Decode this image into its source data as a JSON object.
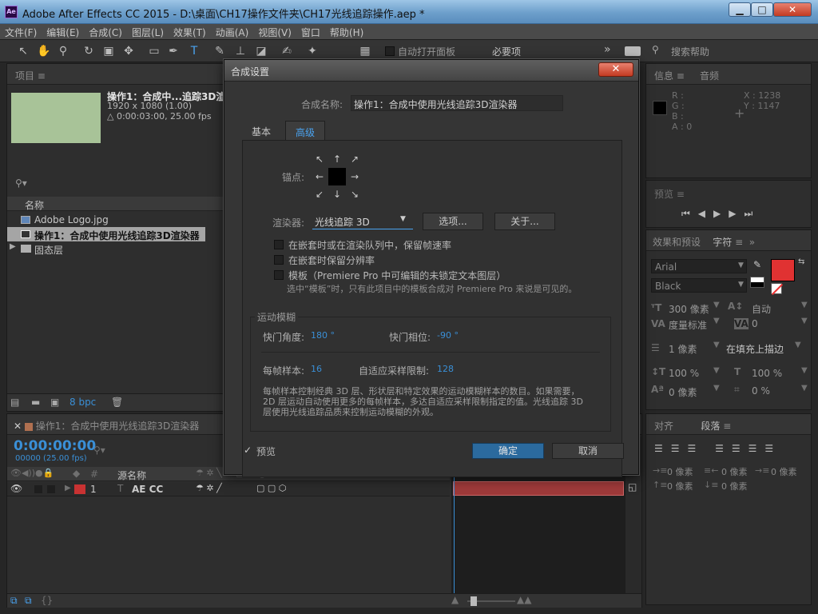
{
  "window": {
    "app_icon": "Ae",
    "title": "Adobe After Effects CC 2015 - D:\\桌面\\CH17操作文件夹\\CH17光线追踪操作.aep *",
    "controls": [
      "▁",
      "□",
      "✕"
    ]
  },
  "menu": [
    "文件(F)",
    "编辑(E)",
    "合成(C)",
    "图层(L)",
    "效果(T)",
    "动画(A)",
    "视图(V)",
    "窗口",
    "帮助(H)"
  ],
  "toolbar": {
    "auto_open_label": "自动打开面板",
    "workspace": "必要项",
    "search_help": "搜索帮助"
  },
  "project": {
    "tab": "项目",
    "comp_name": "操作1：合成中...追踪3D渲",
    "comp_resolution": "1920 x 1080 (1.00)",
    "comp_duration": "△ 0:00:03:00, 25.00 fps",
    "thumb_color": "#a8c398",
    "column_name": "名称",
    "items": [
      {
        "icon": "image-icon",
        "name": "Adobe Logo.jpg"
      },
      {
        "icon": "comp-icon",
        "name": "操作1：合成中使用光线追踪3D渲染器"
      },
      {
        "icon": "folder-icon",
        "name": "固态层"
      }
    ],
    "bpc": "8 bpc"
  },
  "info": {
    "tab_info": "信息",
    "tab_audio": "音频",
    "r": "R :",
    "g": "G :",
    "b": "B :",
    "a": "A : 0",
    "x": "X : 1238",
    "y": "Y : 1147"
  },
  "preview": {
    "tab": "预览"
  },
  "character": {
    "tab_effects": "效果和预设",
    "tab_char": "字符",
    "font": "Arial",
    "style": "Black",
    "size": "300 像素",
    "leading": "自动",
    "kerning": "度量标准",
    "tracking": "0",
    "stroke_width": "1 像素",
    "stroke_type": "在填充上描边",
    "vscale": "100 %",
    "hscale": "100 %",
    "baseline": "0 像素",
    "tsume": "0 %",
    "fill_color": "#e03232"
  },
  "paragraph": {
    "tab_align": "对齐",
    "tab_para": "段落",
    "indent": [
      "0 像素",
      "0 像素",
      "0 像素",
      "0 像素",
      "0 像素"
    ]
  },
  "timeline": {
    "tab": "操作1：合成中使用光线追踪3D渲染器",
    "timecode": "0:00:00:00",
    "frames": "00000 (25.00 fps)",
    "col_hash": "#",
    "col_source": "源名称",
    "layer_num": "1",
    "layer_name": "AE CC",
    "layer_color": "#c83232"
  },
  "dialog": {
    "title": "合成设置",
    "close": "✕",
    "name_label": "合成名称:",
    "name_value": "操作1：合成中使用光线追踪3D渲染器",
    "tab_basic": "基本",
    "tab_advanced": "高级",
    "anchor_label": "锚点:",
    "renderer_label": "渲染器:",
    "renderer_value": "光线追踪 3D",
    "options_btn": "选项...",
    "about_btn": "关于...",
    "opt1": "在嵌套时或在渲染队列中，保留帧速率",
    "opt2": "在嵌套时保留分辨率",
    "opt3": "模板（Premiere Pro 中可编辑的未锁定文本图层）",
    "opt3_note": "选中“模板”时，只有此项目中的模板合成对 Premiere Pro 来说是可见的。",
    "motion_blur": "运动模糊",
    "shutter_angle_label": "快门角度:",
    "shutter_angle": "180 °",
    "shutter_phase_label": "快门相位:",
    "shutter_phase": "-90 °",
    "samples_label": "每帧样本:",
    "samples": "16",
    "adaptive_label": "自适应采样限制:",
    "adaptive": "128",
    "desc": "每帧样本控制经典 3D 层、形状层和特定效果的运动模糊样本的数目。如果需要，2D 层运动自动使用更多的每帧样本，多达自适应采样限制指定的值。光线追踪 3D 层使用光线追踪品质来控制运动模糊的外观。",
    "preview": "预览",
    "ok": "确定",
    "cancel": "取消"
  }
}
